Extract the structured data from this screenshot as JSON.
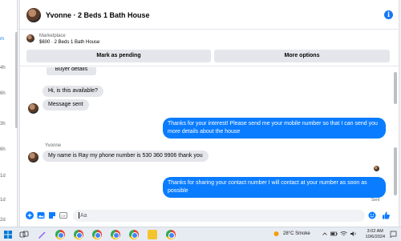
{
  "background_page": {
    "items": [
      "m",
      "4h",
      "6h",
      "3h",
      "6h",
      "1d",
      "1d",
      "2d"
    ]
  },
  "chat": {
    "title": "Yvonne · 2 Beds 1 Bath House",
    "info_icon": "i",
    "listing": {
      "category": "Marketplace",
      "item": "$600 · 2 Beds 1 Bath House"
    },
    "buttons": {
      "mark_pending": "Mark as pending",
      "more_options": "More options"
    },
    "messages": [
      {
        "direction": "in",
        "text": "Buyer details"
      },
      {
        "direction": "in",
        "text": "Hi, is this available?"
      },
      {
        "direction": "in",
        "text": "Message sent"
      },
      {
        "direction": "out",
        "text": "Thanks for your interest! Please send me your mobile number so that I can send you more details about the house"
      },
      {
        "direction": "in",
        "sender": "Yvonne",
        "text": "My name is Ray my phone number is 530 360 9906 thank you"
      },
      {
        "direction": "out",
        "text": "Thanks for sharing your contact number I will contact at your number as soon as possible"
      }
    ],
    "sent_status": "Sent",
    "composer": {
      "placeholder": "Aa"
    }
  },
  "taskbar": {
    "weather": "28°C  Smoke",
    "time": "3:02 AM",
    "date": "10/6/2024"
  },
  "colors": {
    "accent": "#0a7cff",
    "brand": "#1877f2"
  }
}
